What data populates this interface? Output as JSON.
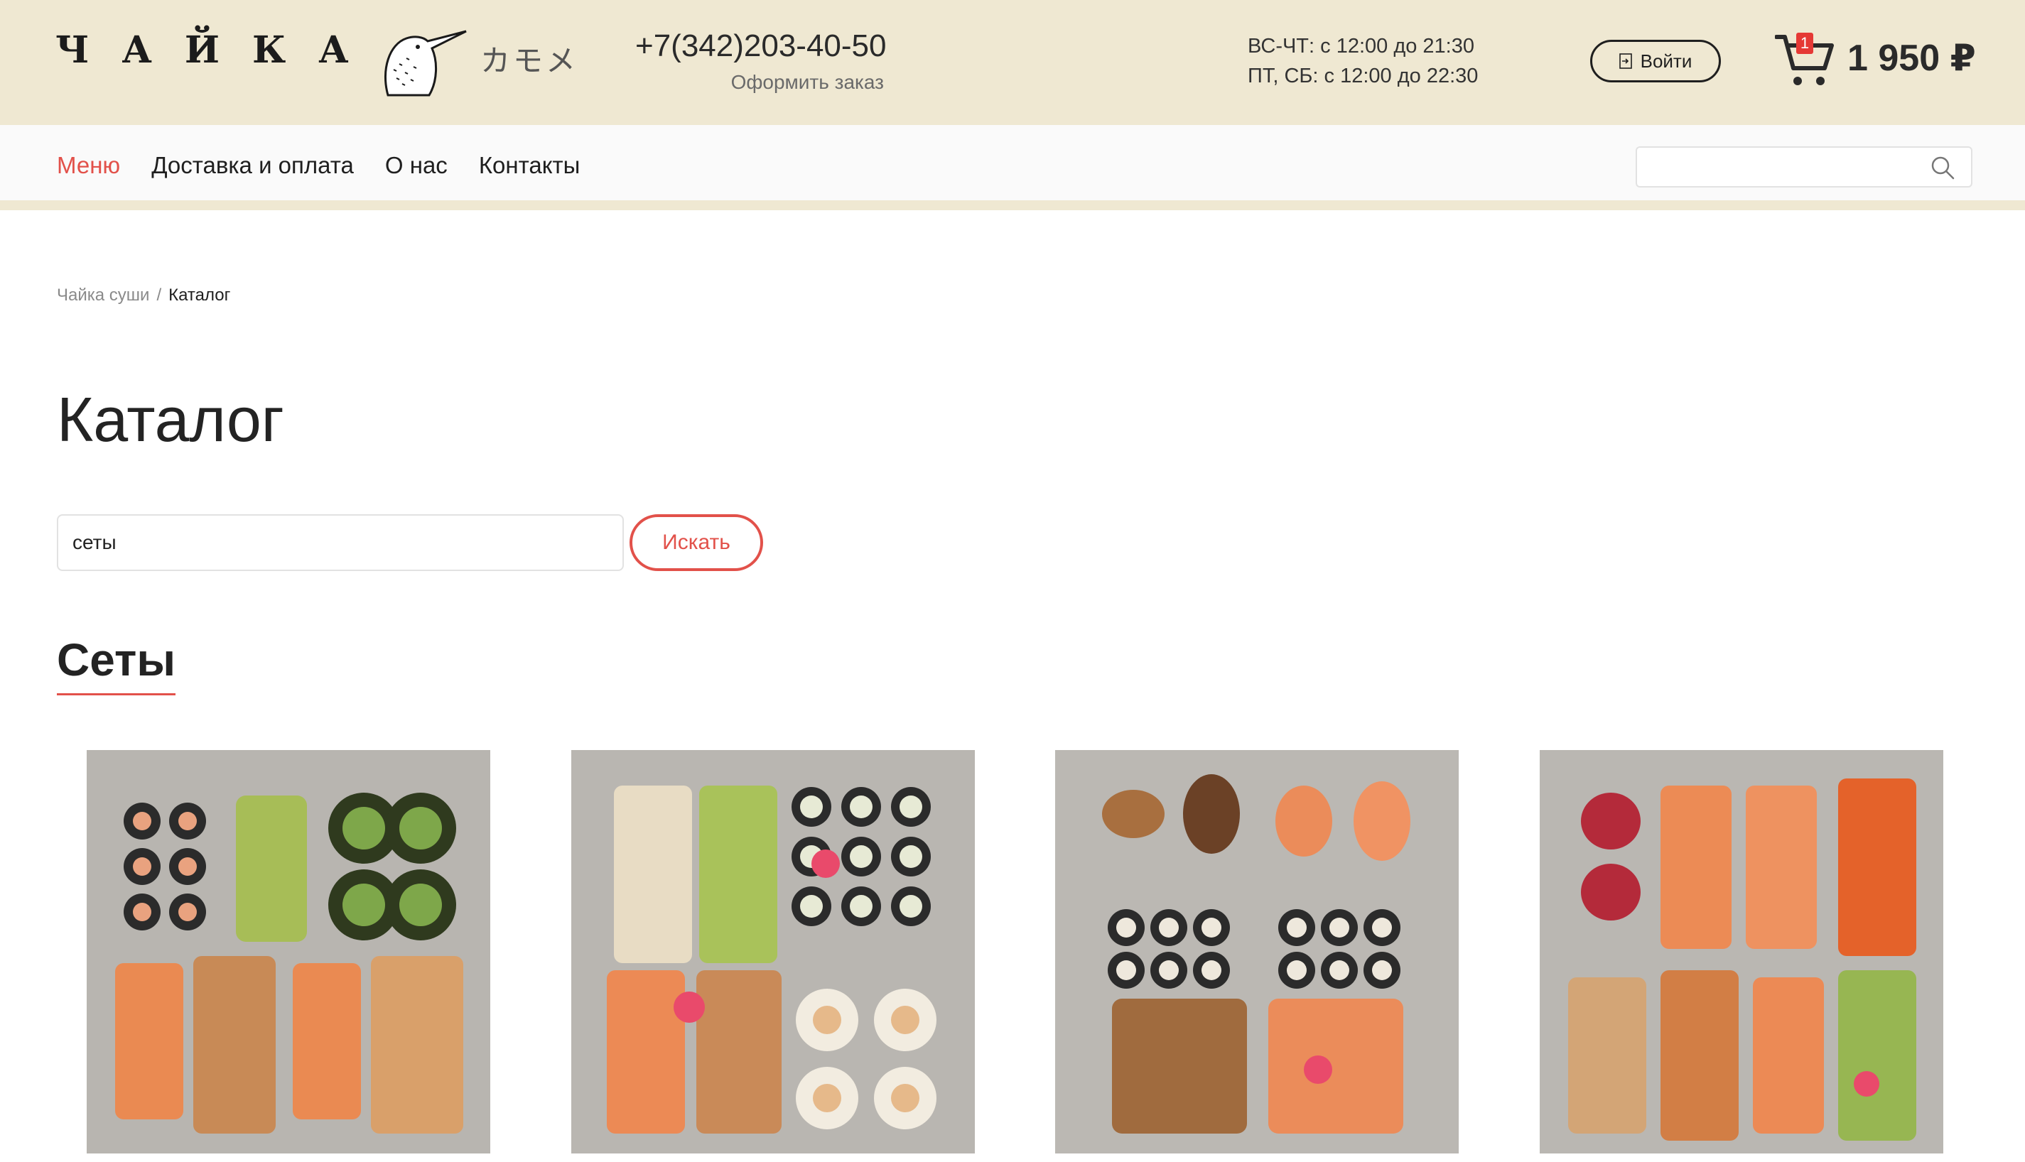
{
  "header": {
    "logo_text": "ЧАЙКА",
    "logo_subtitle": "カモメ",
    "phone": "+7(342)203-40-50",
    "order_link": "Оформить заказ",
    "hours_line1": "ВС-ЧТ: с 12:00 до 21:30",
    "hours_line2": "ПТ, СБ: с 12:00 до 22:30",
    "login_label": "Войти",
    "cart_count": "1",
    "cart_total": "1 950 ₽"
  },
  "nav": {
    "items": [
      {
        "label": "Меню",
        "active": true
      },
      {
        "label": "Доставка и оплата",
        "active": false
      },
      {
        "label": "О нас",
        "active": false
      },
      {
        "label": "Контакты",
        "active": false
      }
    ],
    "search_value": ""
  },
  "breadcrumb": {
    "home": "Чайка суши",
    "separator": "/",
    "current": "Каталог"
  },
  "page": {
    "title": "Каталог",
    "search_value": "сеты",
    "search_button": "Искать",
    "section_title": "Сеты"
  },
  "products": [
    {
      "image": "sushi-set-photo"
    },
    {
      "image": "sushi-set-photo"
    },
    {
      "image": "sushi-set-photo"
    },
    {
      "image": "sushi-set-photo"
    }
  ],
  "colors": {
    "header_bg": "#efe8d2",
    "accent": "#e2514a",
    "badge": "#e53935"
  }
}
